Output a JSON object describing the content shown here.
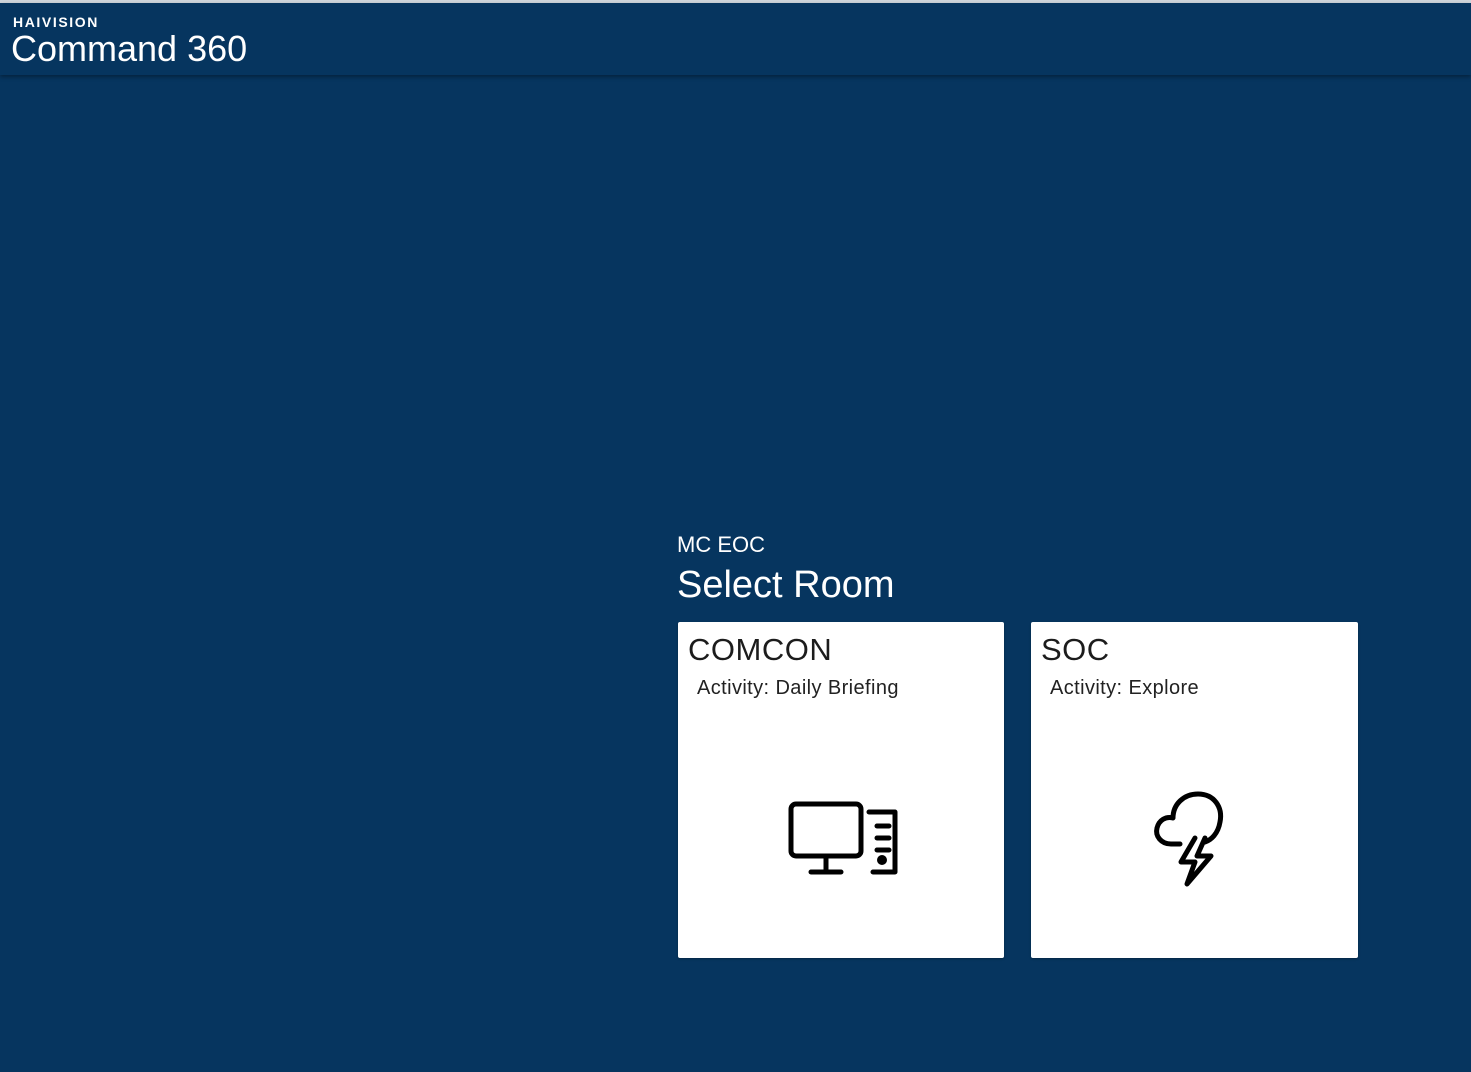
{
  "header": {
    "brand": "HAIVISION",
    "title": "Command 360"
  },
  "main": {
    "site": "MC EOC",
    "heading": "Select Room",
    "rooms": [
      {
        "name": "COMCON",
        "activity": "Activity: Daily Briefing",
        "icon": "desktop-computer-icon"
      },
      {
        "name": "SOC",
        "activity": "Activity: Explore",
        "icon": "cloud-lightning-icon"
      }
    ]
  },
  "colors": {
    "background": "#06355f",
    "card": "#ffffff",
    "text_on_dark": "#ffffff",
    "text_on_card": "#1c1c1c"
  }
}
